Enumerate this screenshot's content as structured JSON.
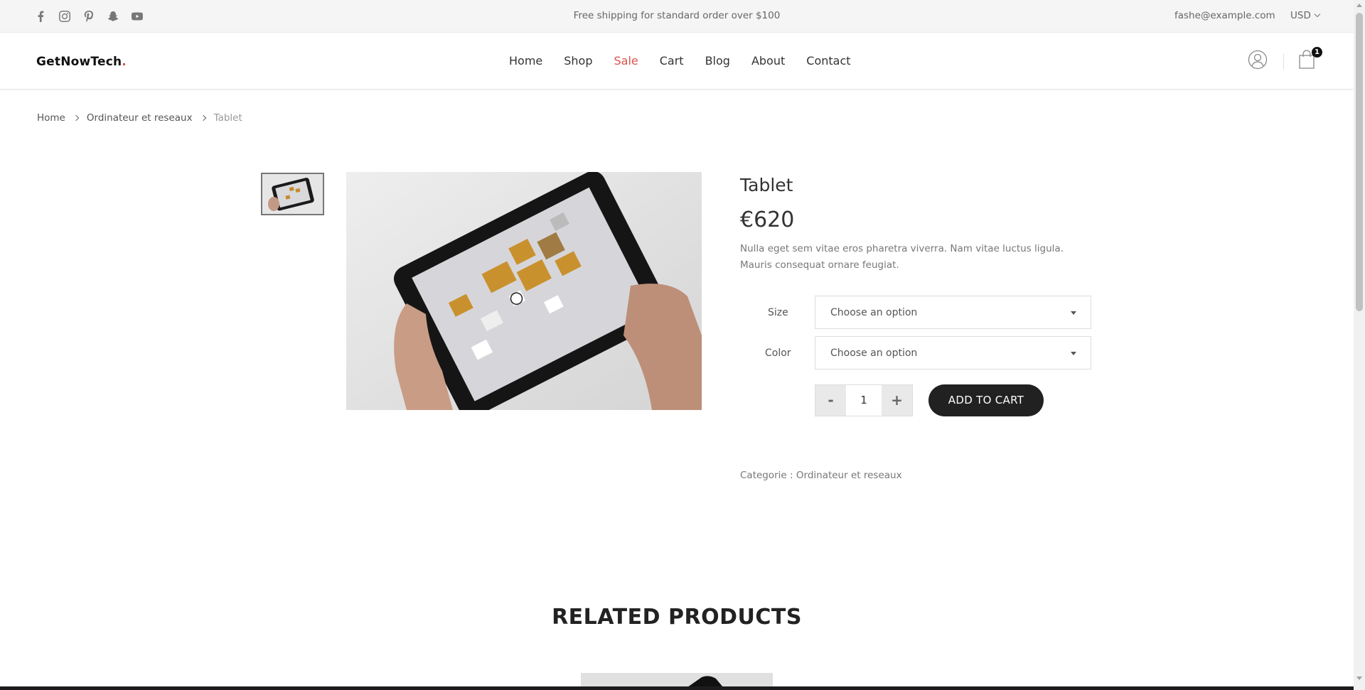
{
  "topbar": {
    "social_icons": [
      "facebook-icon",
      "instagram-icon",
      "pinterest-icon",
      "snapchat-icon",
      "youtube-icon"
    ],
    "promo": "Free shipping for standard order over $100",
    "email": "fashe@example.com",
    "currency": "USD"
  },
  "header": {
    "logo_text": "GetNowTech",
    "logo_dot": ".",
    "nav": [
      {
        "label": "Home"
      },
      {
        "label": "Shop"
      },
      {
        "label": "Sale"
      },
      {
        "label": "Cart"
      },
      {
        "label": "Blog"
      },
      {
        "label": "About"
      },
      {
        "label": "Contact"
      }
    ],
    "cart_count": "1"
  },
  "breadcrumb": {
    "items": [
      "Home",
      "Ordinateur et reseaux"
    ],
    "current": "Tablet"
  },
  "product": {
    "title": "Tablet",
    "price": "€620",
    "description": "Nulla eget sem vitae eros pharetra viverra. Nam vitae luctus ligula. Mauris consequat ornare feugiat.",
    "options": [
      {
        "label": "Size",
        "value": "Choose an option"
      },
      {
        "label": "Color",
        "value": "Choose an option"
      }
    ],
    "quantity": "1",
    "qty_minus": "-",
    "qty_plus": "+",
    "add_to_cart": "ADD TO CART",
    "category_label": "Categorie : ",
    "category": "Ordinateur et reseaux"
  },
  "related": {
    "title": "RELATED PRODUCTS"
  },
  "colors": {
    "accent": "#d9534f",
    "button": "#212121"
  }
}
